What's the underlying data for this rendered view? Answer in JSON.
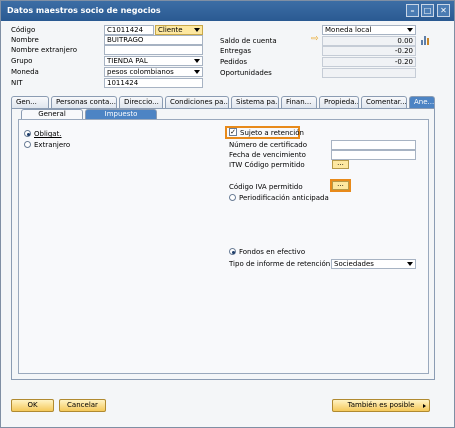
{
  "window": {
    "title": "Datos maestros socio de negocios",
    "buttons": {
      "minimize": "–",
      "maximize": "□",
      "close": "✕"
    }
  },
  "header": {
    "codigo_label": "Código",
    "codigo_value": "C1011424",
    "tipo_value": "Cliente",
    "nombre_label": "Nombre",
    "nombre_value": "BUITRAGO",
    "nombre_extranjero_label": "Nombre extranjero",
    "nombre_extranjero_value": "",
    "grupo_label": "Grupo",
    "grupo_value": "TIENDA PAL",
    "moneda_label": "Moneda",
    "moneda_value": "pesos colombianos",
    "nit_label": "NIT",
    "nit_value": "1011424",
    "moneda_local_value": "Moneda local",
    "saldo_label": "Saldo de cuenta",
    "saldo_value": "0.00",
    "entregas_label": "Entregas",
    "entregas_value": "-0.20",
    "pedidos_label": "Pedidos",
    "pedidos_value": "-0.20",
    "oportunidades_label": "Oportunidades",
    "oportunidades_value": ""
  },
  "tabs": [
    "Gen...",
    "Personas conta...",
    "Direccio...",
    "Condiciones pa...",
    "Sistema pa...",
    "Finan...",
    "Propieda...",
    "Comentar...",
    "Ane..."
  ],
  "subtabs": [
    "General",
    "Impuesto"
  ],
  "impuesto": {
    "obligat_label": "Obligat.",
    "extranjero_label": "Extranjero",
    "sujeto_label": "Sujeto a retención",
    "sujeto_checked": true,
    "num_cert_label": "Número de certificado",
    "fecha_venc_label": "Fecha de vencimiento",
    "itw_label": "ITW Código permitido",
    "iva_label": "Código IVA permitido",
    "periodificacion_label": "Periodificación anticipada",
    "fondos_label": "Fondos en efectivo",
    "tipo_informe_label": "Tipo de informe de retención",
    "tipo_informe_value": "Sociedades",
    "dots_label": "..."
  },
  "footer": {
    "ok_label": "OK",
    "cancel_label": "Cancelar",
    "also_possible_label": "También es posible"
  },
  "colors": {
    "title_bar": "#2a5a92",
    "highlight": "#e88a1a",
    "button_yellow": "#f5c95a",
    "active_tab": "#4d84c4"
  }
}
